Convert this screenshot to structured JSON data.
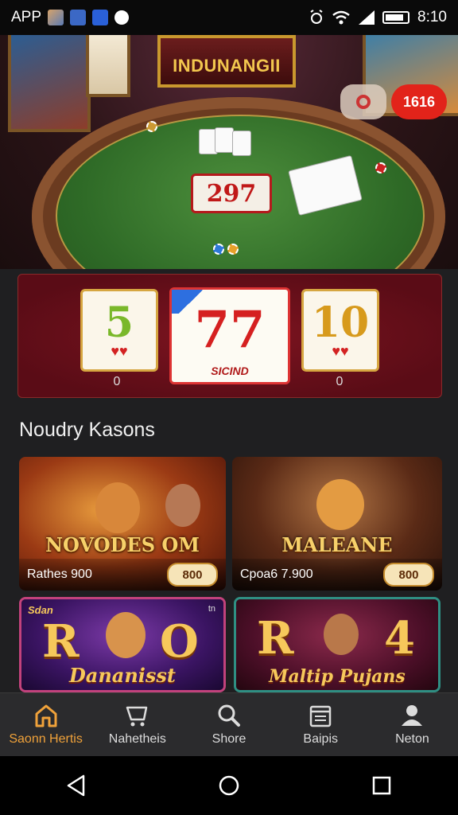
{
  "status_bar": {
    "app_label": "APP",
    "time": "8:10",
    "icons": [
      "photo-icon",
      "app-icon",
      "app-icon",
      "pin-icon",
      "alarm-icon",
      "wifi-icon",
      "signal-icon",
      "battery-icon"
    ]
  },
  "hero": {
    "sign_text": "INDUNANGII",
    "slot_text": "297",
    "badge_label": "1616",
    "search_icon": "search-icon"
  },
  "slot_banner": {
    "reels": [
      {
        "symbol": "5",
        "caption": "0"
      },
      {
        "symbol": "77",
        "tag": "SICIND"
      },
      {
        "symbol": "10",
        "caption": "0"
      }
    ]
  },
  "section": {
    "title": "Noudry Kasons"
  },
  "games": [
    {
      "title": "NOVODES OM",
      "meta": "Rathes 900",
      "price": "800"
    },
    {
      "title": "MALEANE",
      "meta": "Cpoa6 7.900",
      "price": "800"
    },
    {
      "title_letters": [
        "R",
        "O"
      ],
      "script": "Dananisst",
      "corner_text": "Sdan",
      "corner_right": "tn"
    },
    {
      "title_letters": [
        "R",
        "4"
      ],
      "script": "Maltip Pujans"
    }
  ],
  "bottom_nav": {
    "items": [
      {
        "label": "Saonn Hertis",
        "icon": "home-icon",
        "active": true
      },
      {
        "label": "Nahetheis",
        "icon": "cart-icon",
        "active": false
      },
      {
        "label": "Shore",
        "icon": "search-icon",
        "active": false
      },
      {
        "label": "Baipis",
        "icon": "calendar-icon",
        "active": false
      },
      {
        "label": "Neton",
        "icon": "profile-icon",
        "active": false
      }
    ]
  },
  "colors": {
    "accent": "#f0a23a",
    "badge_red": "#e2231a",
    "banner_red": "#7d1420",
    "nav_bg": "#2b2b2d",
    "page_bg": "#1f1f21"
  }
}
